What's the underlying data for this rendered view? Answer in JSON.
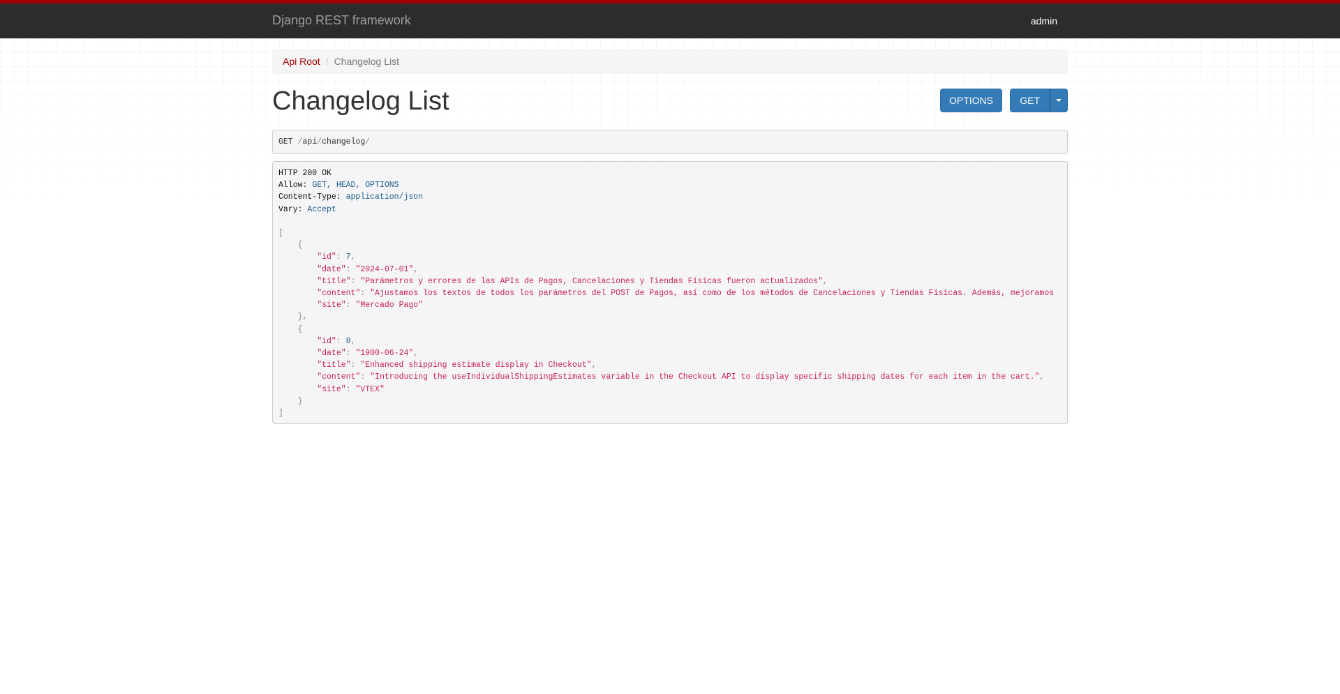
{
  "navbar": {
    "brand": "Django REST framework",
    "user": "admin"
  },
  "breadcrumb": {
    "root": "Api Root",
    "current": "Changelog List"
  },
  "page": {
    "title": "Changelog List",
    "options_label": "OPTIONS",
    "get_label": "GET"
  },
  "request": {
    "method": "GET",
    "path_segments": [
      "api",
      "changelog"
    ]
  },
  "response": {
    "status": "HTTP 200 OK",
    "headers": [
      {
        "name": "Allow:",
        "value": "GET, HEAD, OPTIONS"
      },
      {
        "name": "Content-Type:",
        "value": "application/json"
      },
      {
        "name": "Vary:",
        "value": "Accept"
      }
    ],
    "items": [
      {
        "id": "7",
        "date": "\"2024-07-01\"",
        "title": "\"Parámetros y errores de las APIs de Pagos, Cancelaciones y Tiendas Físicas fueron actualizados\"",
        "content": "\"Ajustamos los textos de todos los parámetros del POST de Pagos, así como de los métodos de Cancelaciones y Tiendas Físicas. Además, mejoramos",
        "site": "\"Mercado Pago\""
      },
      {
        "id": "8",
        "date": "\"1900-06-24\"",
        "title": "\"Enhanced shipping estimate display in Checkout\"",
        "content": "\"Introducing the useIndividualShippingEstimates variable in the Checkout API to display specific shipping dates for each item in the cart.\"",
        "site": "\"VTEX\""
      }
    ]
  },
  "colors": {
    "accent_red": "#a30000",
    "navbar_bg": "#2c2c2c",
    "button_blue": "#337ab7",
    "json_string": "#c7254e",
    "json_number": "#1b5e8a"
  }
}
